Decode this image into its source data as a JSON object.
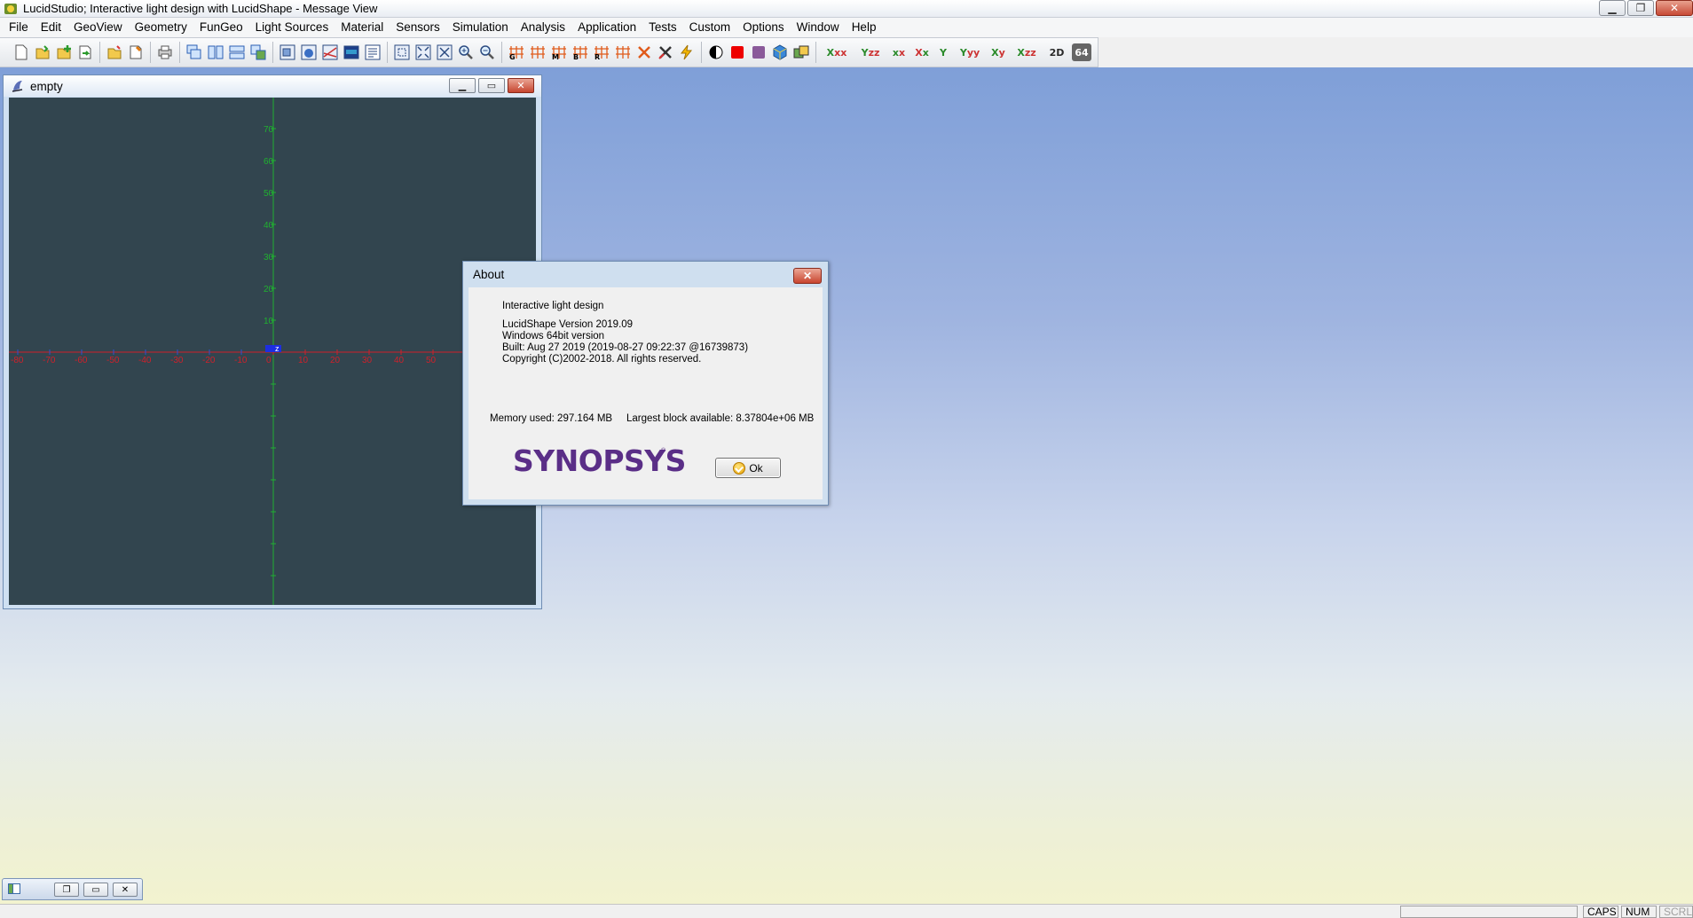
{
  "app": {
    "title": "LucidStudio; Interactive light design with LucidShape - Message View"
  },
  "menu": [
    {
      "label": "File"
    },
    {
      "label": "Edit"
    },
    {
      "label": "GeoView"
    },
    {
      "label": "Geometry"
    },
    {
      "label": "FunGeo"
    },
    {
      "label": "Light Sources"
    },
    {
      "label": "Material"
    },
    {
      "label": "Sensors"
    },
    {
      "label": "Simulation"
    },
    {
      "label": "Analysis"
    },
    {
      "label": "Application"
    },
    {
      "label": "Tests"
    },
    {
      "label": "Custom"
    },
    {
      "label": "Options"
    },
    {
      "label": "Window"
    },
    {
      "label": "Help"
    }
  ],
  "toolbar": {
    "label_2d": "2D",
    "label_64": "64",
    "axis_labels": [
      "Xxx",
      "Yzz",
      "xx",
      "Y",
      "Yyy",
      "Xy",
      "Xzz"
    ]
  },
  "child_window": {
    "title": "empty",
    "x_ticks": [
      "-80",
      "-70",
      "-60",
      "-50",
      "-40",
      "-30",
      "-20",
      "-10",
      "0",
      "10",
      "20",
      "30",
      "40",
      "50"
    ],
    "y_ticks": [
      "70",
      "60",
      "50",
      "40",
      "30",
      "20",
      "10"
    ],
    "origin_label": "z"
  },
  "about": {
    "title": "About",
    "tagline": "Interactive light design",
    "version": "LucidShape Version 2019.09",
    "platform": "Windows 64bit version",
    "built": "Built: Aug 27 2019 (2019-08-27 09:22:37 @16739873)",
    "copyright": "Copyright (C)2002-2018. All rights reserved.",
    "memory_used": "Memory used: 297.164 MB",
    "largest_block": "Largest block available: 8.37804e+06 MB",
    "logo": "SYNOPSYS",
    "logo_reg": "®",
    "ok_label": "Ok"
  },
  "statusbar": {
    "caps": "CAPS",
    "num": "NUM",
    "scrl": "SCRL"
  },
  "colors": {
    "viewport_bg": "#32454f",
    "axis_x": "#d0202a",
    "axis_y": "#20b030",
    "logo": "#5a2e87"
  }
}
